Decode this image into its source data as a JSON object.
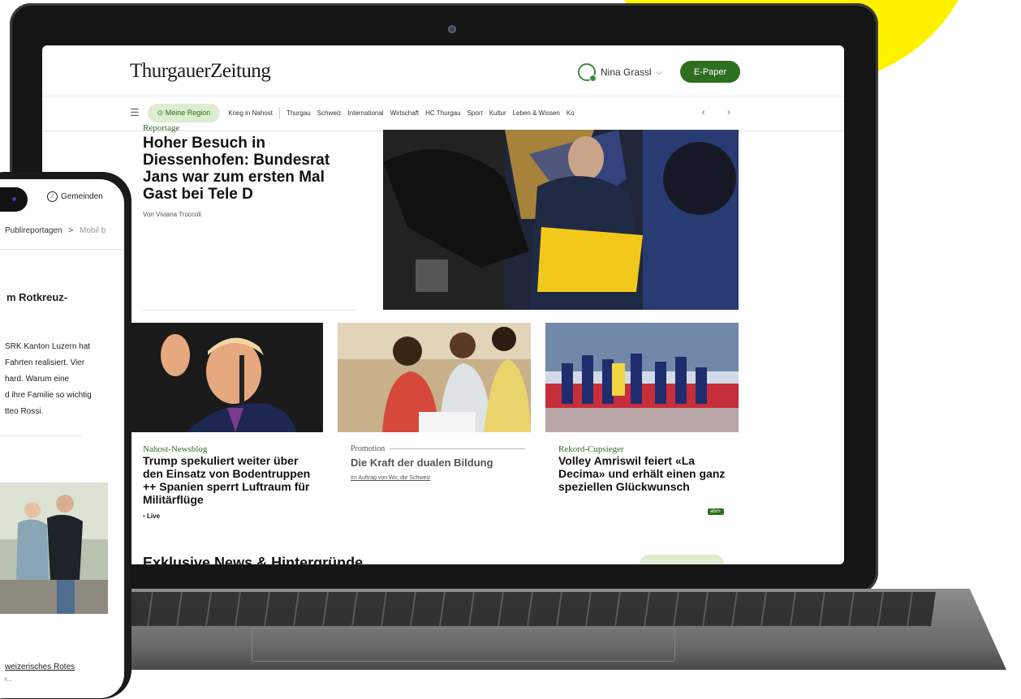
{
  "laptop": {
    "logo": "ThurgauerZeitung",
    "user": {
      "name": "Nina Grassl",
      "chevron": "⌵"
    },
    "epaper_label": "E-Paper",
    "nav": {
      "menu_icon": "☰",
      "region_label": "Meine Region",
      "items": [
        "Krieg in Nahost",
        "Thurgau",
        "Schweiz",
        "International",
        "Wirtschaft",
        "HC Thurgau",
        "Sport",
        "Kultur",
        "Leben & Wissen",
        "Ko"
      ],
      "arrows": "‹ ›"
    },
    "lead": {
      "overline": "Reportage",
      "title": "Hoher Besuch in Diessenhofen: Bundesrat Jans war zum ersten Mal Gast bei Tele D",
      "author": "Von Viviana Troccoli"
    },
    "cards": [
      {
        "overline": "Nahost-Newsblog",
        "title": "Trump spekuliert weiter über den Einsatz von Bodentruppen ++ Spanien sperrt Luftraum für Militärflüge",
        "live": "Live",
        "live_dot": "•"
      },
      {
        "overline": "Promotion",
        "title": "Die Kraft der dualen Bildung",
        "sub": "Im Auftrag von Wir, die Schweiz"
      },
      {
        "overline": "Rekord-Cupsieger",
        "title": "Volley Amriswil feiert «La Decima» und erhält einen ganz speziellen Glückwunsch",
        "badge": "abo+"
      }
    ],
    "section_heading": "Exklusive News & Hintergründe"
  },
  "phone": {
    "gemeinden_label": "Gemeinden",
    "breadcrumb": {
      "item": "Publireportagen",
      "sep": ">",
      "next": "Mobil b"
    },
    "title": "m Rotkreuz-",
    "text_lines": [
      "SRK Kanton Luzern hat",
      "Fahrten realisiert. Vier",
      "hard. Warum eine",
      "d ihre Familie so wichtig",
      "tteo Rossi."
    ],
    "footer_link": "weizerisches Rotes",
    "footer_text": "r..."
  },
  "colors": {
    "accent_green": "#2d6e1f",
    "region_bg": "#dcedd0",
    "sun_yellow": "#fff200"
  }
}
